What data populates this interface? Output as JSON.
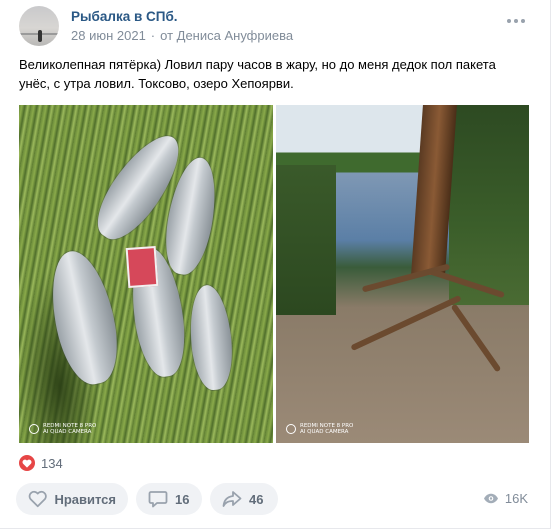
{
  "post": {
    "group_name": "Рыбалка в СПб.",
    "date": "28 июн 2021",
    "author": "от Дениса Ануфриева",
    "text": "Великолепная пятёрка) Ловил пару часов в жару, но до меня дедок пол пакета унёс, с утра ловил. Токсово, озеро Хепоярви."
  },
  "photos": [
    {
      "watermark_line1": "REDMI NOTE 8 PRO",
      "watermark_line2": "AI QUAD CAMERA"
    },
    {
      "watermark_line1": "REDMI NOTE 8 PRO",
      "watermark_line2": "AI QUAD CAMERA"
    }
  ],
  "reactions": {
    "likes_count": "134"
  },
  "actions": {
    "like_label": "Нравится",
    "comments_count": "16",
    "shares_count": "46",
    "views_count": "16K"
  },
  "icons": {
    "more": "more-horizontal-icon",
    "heart": "heart-icon",
    "comment": "comment-icon",
    "share": "share-icon",
    "views": "eye-icon"
  },
  "colors": {
    "link": "#2a5885",
    "meta": "#818c99",
    "button_bg": "#f0f2f5",
    "like_red": "#e64646"
  }
}
